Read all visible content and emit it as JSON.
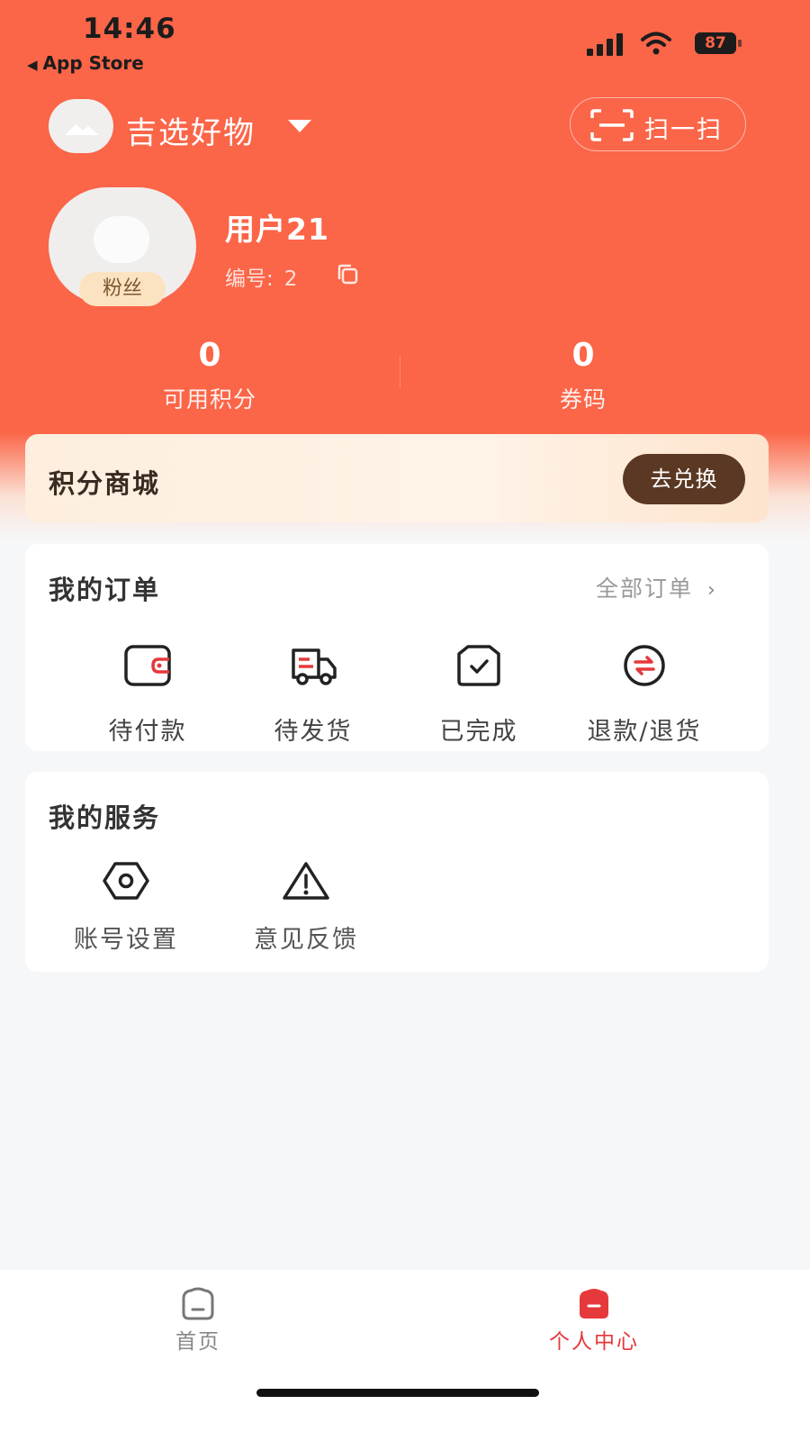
{
  "status_bar": {
    "time": "14:46",
    "back_app": "App Store",
    "back_glyph": "◀",
    "battery": "87"
  },
  "header": {
    "store_name": "吉选好物",
    "scan_label": "扫一扫"
  },
  "profile": {
    "badge": "粉丝",
    "username": "用户21",
    "id_label": "编号:",
    "id_value": "2"
  },
  "stats": [
    {
      "value": "0",
      "label": "可用积分"
    },
    {
      "value": "0",
      "label": "券码"
    }
  ],
  "points_mall": {
    "title": "积分商城",
    "button": "去兑换"
  },
  "orders": {
    "title": "我的订单",
    "all_link": "全部订单",
    "all_chevron": "›",
    "items": [
      {
        "label": "待付款",
        "icon": "wallet-icon"
      },
      {
        "label": "待发货",
        "icon": "delivery-truck-icon"
      },
      {
        "label": "已完成",
        "icon": "check-box-icon"
      },
      {
        "label": "退款/退货",
        "icon": "refund-icon"
      }
    ]
  },
  "services": {
    "title": "我的服务",
    "items": [
      {
        "label": "账号设置",
        "icon": "settings-hexagon-icon"
      },
      {
        "label": "意见反馈",
        "icon": "warning-triangle-icon"
      }
    ]
  },
  "tabbar": {
    "items": [
      {
        "label": "首页",
        "icon": "home-icon",
        "active": false
      },
      {
        "label": "个人中心",
        "icon": "profile-icon",
        "active": true
      }
    ]
  },
  "colors": {
    "brand": "#fb6548",
    "accent_red": "#e5393c",
    "mall_button": "#5a3823",
    "active_tab": "#e5393c"
  }
}
